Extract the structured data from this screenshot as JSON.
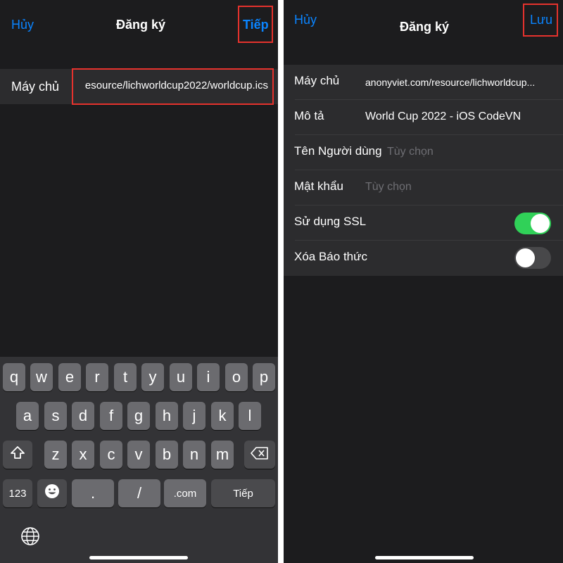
{
  "left": {
    "cancel_label": "Hủy",
    "title": "Đăng ký",
    "next_label": "Tiếp",
    "server_label": "Máy chủ",
    "server_value": "esource/lichworldcup2022/worldcup.ics",
    "keyboard": {
      "row1": [
        "q",
        "w",
        "e",
        "r",
        "t",
        "y",
        "u",
        "i",
        "o",
        "p"
      ],
      "row2": [
        "a",
        "s",
        "d",
        "f",
        "g",
        "h",
        "j",
        "k",
        "l"
      ],
      "row3": [
        "z",
        "x",
        "c",
        "v",
        "b",
        "n",
        "m"
      ],
      "numbers_label": "123",
      "dot_label": ".",
      "slash_label": "/",
      "dotcom_label": ".com",
      "return_label": "Tiếp"
    }
  },
  "right": {
    "cancel_label": "Hủy",
    "title": "Đăng ký",
    "save_label": "Lưu",
    "fields": {
      "server_label": "Máy chủ",
      "server_value": "anonyviet.com/resource/lichworldcup...",
      "description_label": "Mô tả",
      "description_value": "World Cup 2022 - iOS CodeVN",
      "username_label": "Tên Người dùng",
      "username_placeholder": "Tùy chọn",
      "password_label": "Mật khẩu",
      "password_placeholder": "Tùy chọn",
      "ssl_label": "Sử dụng SSL",
      "ssl_on": true,
      "remove_alarms_label": "Xóa Báo thức",
      "remove_alarms_on": false
    }
  },
  "colors": {
    "accent": "#0a84ff",
    "highlight": "#e5322d",
    "toggle_on": "#30d158",
    "toggle_off": "#48484a"
  }
}
